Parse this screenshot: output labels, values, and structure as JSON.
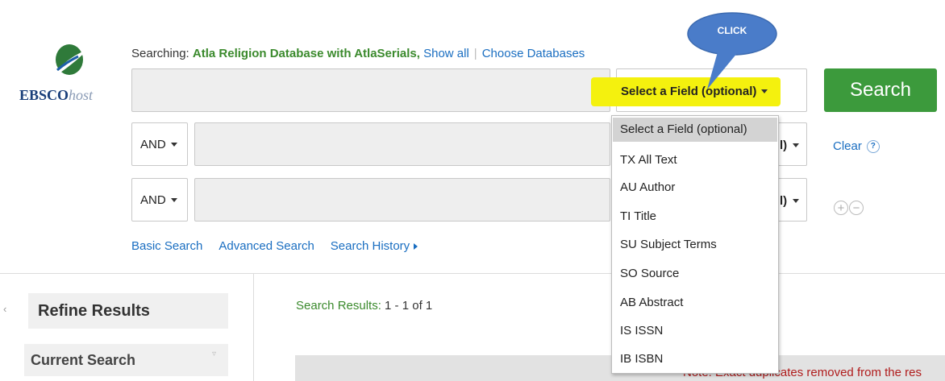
{
  "logo": {
    "brand": "EBSCO",
    "suffix": "host"
  },
  "searching": {
    "prefix": "Searching: ",
    "database": "Atla Religion Database with AtlaSerials,",
    "show_all": "Show all",
    "choose_databases": "Choose Databases"
  },
  "callout": {
    "text": "CLICK"
  },
  "main_row": {
    "field_select": "Select a Field (optional)",
    "search_button": "Search"
  },
  "rows": [
    {
      "operator": "AND",
      "field_tail": "l)"
    },
    {
      "operator": "AND",
      "field_tail": "l)"
    }
  ],
  "clear": {
    "label": "Clear",
    "help": "?"
  },
  "add_remove": {
    "add": "+",
    "remove": "−"
  },
  "links": {
    "basic": "Basic Search",
    "advanced": "Advanced Search",
    "history": "Search History"
  },
  "sidebar": {
    "collapse": "‹",
    "refine": "Refine Results",
    "current": "Current Search"
  },
  "results": {
    "label": "Search Results: ",
    "count": "1 - 1 of 1"
  },
  "note": "Note: Exact duplicates removed from the res",
  "dropdown": {
    "options": [
      "Select a Field (optional)",
      "TX All Text",
      "AU Author",
      "TI Title",
      "SU Subject Terms",
      "SO Source",
      "AB Abstract",
      "IS ISSN",
      "IB ISBN"
    ]
  },
  "colors": {
    "accent_blue": "#1a6ec1",
    "db_green": "#3b8a2d",
    "search_button": "#3c9a3c",
    "highlight_yellow": "#f4f10e",
    "callout_blue": "#4a7cc9",
    "note_red": "#b01c1c"
  }
}
